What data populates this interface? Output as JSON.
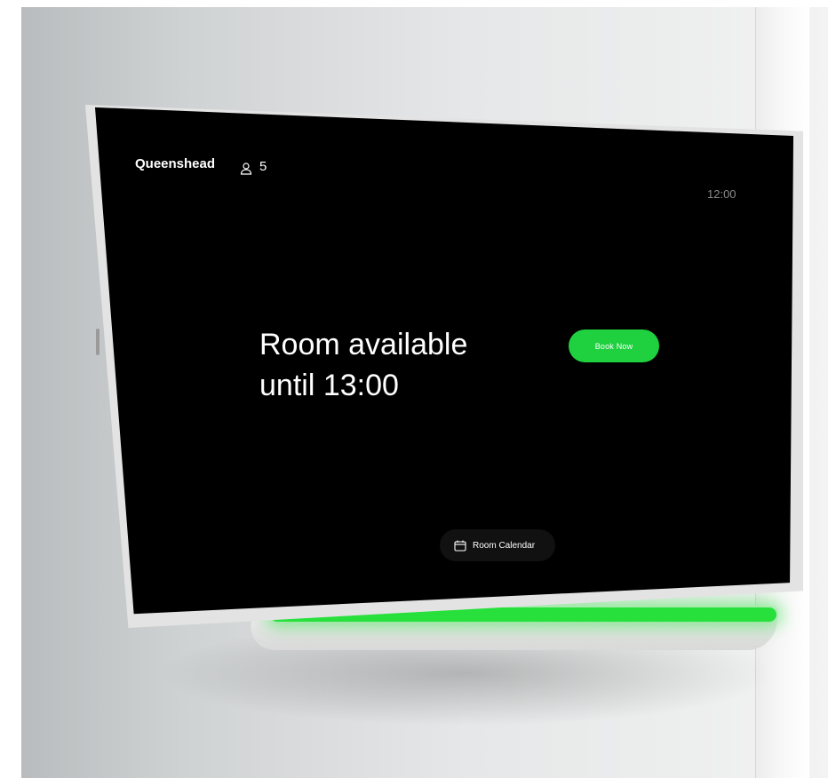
{
  "header": {
    "room_name": "Queenshead",
    "person_icon": "person-icon",
    "capacity": "5",
    "time": "12:00"
  },
  "main": {
    "status_title": "Room available\n until 13:00",
    "book_button_label": "Book Now"
  },
  "footer": {
    "calendar_icon": "calendar-icon",
    "calendar_label": "Room Calendar"
  },
  "colors": {
    "accent_green": "#1fd13f",
    "screen_bg": "#000000",
    "led_glow": "#27e03b"
  }
}
